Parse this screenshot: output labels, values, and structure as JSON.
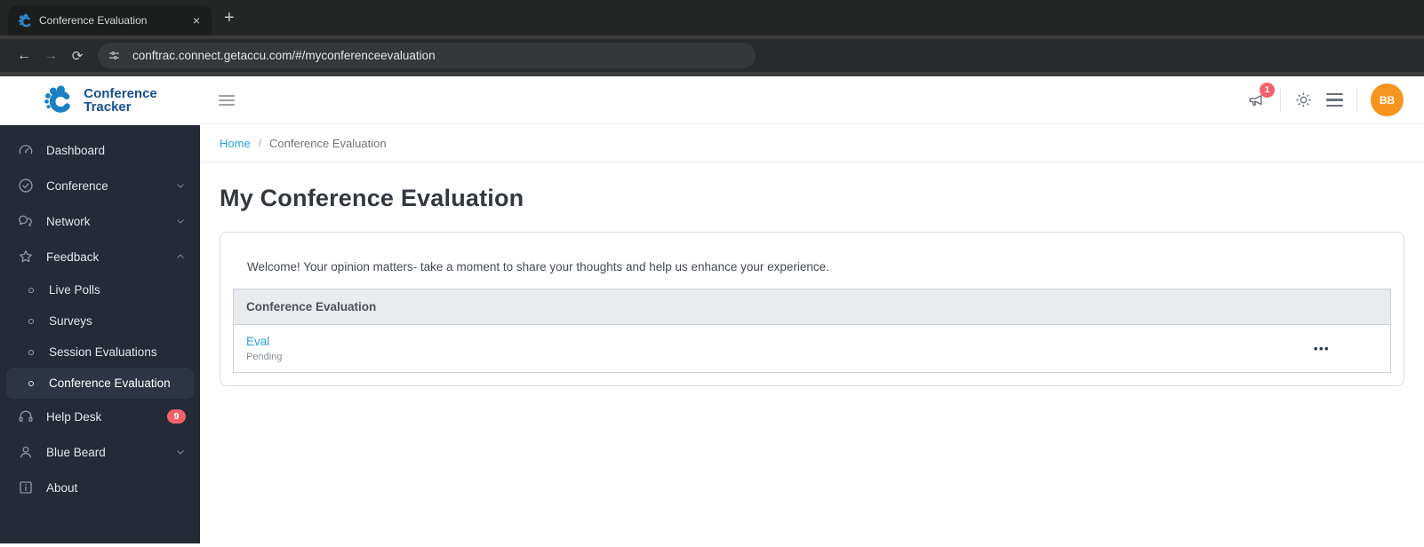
{
  "browser": {
    "tab_title": "Conference Evaluation",
    "close_glyph": "×",
    "new_tab_glyph": "+",
    "back_glyph": "←",
    "forward_glyph": "→",
    "reload_glyph": "⟳",
    "url": "conftrac.connect.getaccu.com/#/myconferenceevaluation"
  },
  "appbar": {
    "logo_line1": "Conference",
    "logo_line2": "Tracker",
    "notification_count": "1",
    "avatar_initials": "BB"
  },
  "sidebar": {
    "items": [
      {
        "label": "Dashboard",
        "icon": "dashboard-icon"
      },
      {
        "label": "Conference",
        "icon": "check-circle-icon",
        "chevron": "down"
      },
      {
        "label": "Network",
        "icon": "chat-icon",
        "chevron": "down"
      },
      {
        "label": "Feedback",
        "icon": "star-icon",
        "chevron": "up",
        "expanded": true
      },
      {
        "label": "Live Polls",
        "sub": true
      },
      {
        "label": "Surveys",
        "sub": true
      },
      {
        "label": "Session Evaluations",
        "sub": true
      },
      {
        "label": "Conference Evaluation",
        "sub": true,
        "active": true
      },
      {
        "label": "Help Desk",
        "icon": "headset-icon",
        "badge": "9"
      },
      {
        "label": "Blue Beard",
        "icon": "user-icon",
        "chevron": "down"
      },
      {
        "label": "About",
        "icon": "info-icon"
      }
    ]
  },
  "breadcrumb": {
    "home": "Home",
    "separator": "/",
    "current": "Conference Evaluation"
  },
  "main": {
    "title": "My Conference Evaluation",
    "welcome": "Welcome! Your opinion matters- take a moment to share your thoughts and help us enhance your experience.",
    "table": {
      "header": "Conference Evaluation",
      "rows": [
        {
          "name": "Eval",
          "status": "Pending",
          "actions": "•••"
        }
      ]
    }
  },
  "colors": {
    "accent_blue": "#29a0da",
    "brand_navy": "#17508e",
    "badge_red": "#f2626e",
    "avatar_orange": "#f7941e",
    "sidebar_bg": "#242a36"
  }
}
